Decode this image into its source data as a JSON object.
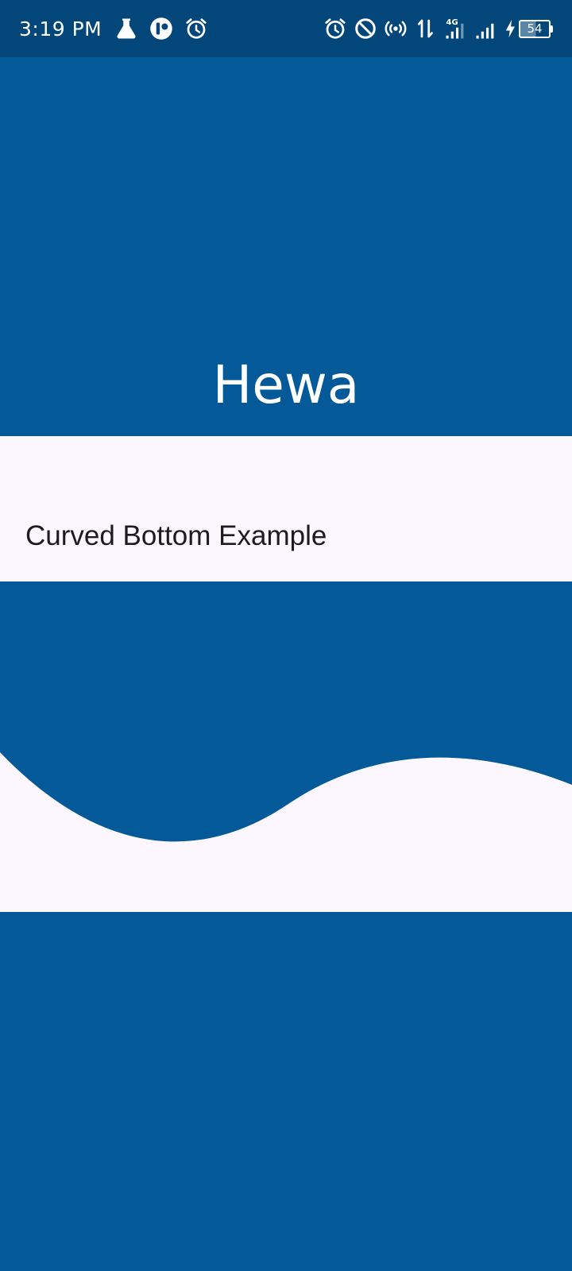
{
  "status_bar": {
    "time": "3:19 PM",
    "left_icons": [
      "flask-icon",
      "app-indicator-icon",
      "alarm-icon"
    ],
    "right_icons": [
      "alarm-icon",
      "do-not-disturb-icon",
      "hotspot-icon",
      "data-transfer-icon",
      "signal-4g-icon",
      "signal-icon",
      "charging-icon"
    ],
    "network_label": "4G",
    "battery_level": "54"
  },
  "header": {
    "title": "Hewa"
  },
  "caption": {
    "text": "Curved Bottom Example"
  },
  "colors": {
    "primary": "#045998",
    "status_bar": "#03467a",
    "surface": "#fcf7fe",
    "on_surface": "#1d1b20",
    "on_primary": "#ffffff"
  }
}
